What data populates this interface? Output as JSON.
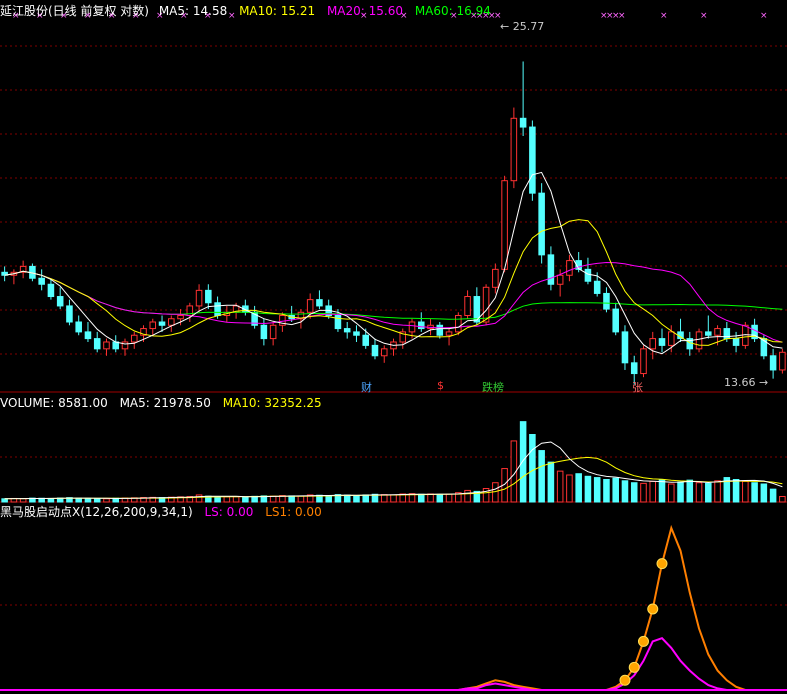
{
  "title": "延江股份(日线 前复权 对数)",
  "ma_legend": [
    {
      "label": "MA5: 14.58",
      "color": "#ffffff"
    },
    {
      "label": "MA10: 15.21",
      "color": "#ffff00"
    },
    {
      "label": "MA20: 15.60",
      "color": "#ff00ff"
    },
    {
      "label": "MA60: 16.94",
      "color": "#00ff00"
    }
  ],
  "volume_legend": [
    {
      "label": "VOLUME: 8581.00",
      "color": "#ffffff"
    },
    {
      "label": "MA5: 21978.50",
      "color": "#ffffff"
    },
    {
      "label": "MA10: 32352.25",
      "color": "#ffff00"
    }
  ],
  "indicator_legend": [
    {
      "label": "黑马股启动点X(12,26,200,9,34,1)",
      "color": "#ffffff"
    },
    {
      "label": "LS: 0.00",
      "color": "#ff00ff"
    },
    {
      "label": "LS1: 0.00",
      "color": "#ff8000"
    }
  ],
  "price_markers": {
    "high": "25.77",
    "low": "13.66"
  },
  "event_markers": [
    {
      "label": "财",
      "color": "#4da6ff"
    },
    {
      "label": "$",
      "color": "#ff3333"
    },
    {
      "label": "跌榜",
      "color": "#33cc33"
    },
    {
      "label": "张",
      "color": "#ff6666"
    }
  ],
  "colors": {
    "up": "#ff3232",
    "down": "#54ffff",
    "grid": "#800000",
    "ma5": "#ffffff",
    "ma10": "#ffff00",
    "ma20": "#ff00ff",
    "ma60": "#00ff00",
    "ls": "#ff00ff",
    "ls1": "#ff7f00"
  },
  "chart_data": {
    "type": "candlestick",
    "scale": "log",
    "price_range": [
      13.3,
      28.0
    ],
    "candles": [
      [
        16.9,
        17.1,
        16.6,
        16.8
      ],
      [
        16.8,
        17.0,
        16.5,
        16.9
      ],
      [
        16.9,
        17.3,
        16.7,
        17.1
      ],
      [
        17.1,
        17.2,
        16.6,
        16.7
      ],
      [
        16.7,
        17.0,
        16.3,
        16.5
      ],
      [
        16.5,
        16.7,
        16.0,
        16.1
      ],
      [
        16.1,
        16.4,
        15.7,
        15.8
      ],
      [
        15.8,
        16.0,
        15.2,
        15.3
      ],
      [
        15.3,
        15.5,
        14.9,
        15.0
      ],
      [
        15.0,
        15.3,
        14.7,
        14.8
      ],
      [
        14.8,
        15.0,
        14.4,
        14.5
      ],
      [
        14.5,
        14.8,
        14.3,
        14.7
      ],
      [
        14.7,
        14.9,
        14.4,
        14.5
      ],
      [
        14.5,
        14.8,
        14.3,
        14.7
      ],
      [
        14.7,
        15.0,
        14.5,
        14.9
      ],
      [
        14.9,
        15.2,
        14.7,
        15.1
      ],
      [
        15.1,
        15.4,
        14.9,
        15.3
      ],
      [
        15.3,
        15.5,
        15.0,
        15.2
      ],
      [
        15.2,
        15.5,
        15.0,
        15.4
      ],
      [
        15.4,
        15.7,
        15.2,
        15.5
      ],
      [
        15.5,
        15.9,
        15.3,
        15.8
      ],
      [
        15.8,
        16.5,
        15.6,
        16.3
      ],
      [
        16.3,
        16.5,
        15.7,
        15.9
      ],
      [
        15.9,
        16.1,
        15.4,
        15.5
      ],
      [
        15.5,
        15.8,
        15.3,
        15.6
      ],
      [
        15.6,
        15.9,
        15.4,
        15.8
      ],
      [
        15.8,
        16.0,
        15.5,
        15.6
      ],
      [
        15.6,
        15.8,
        15.1,
        15.2
      ],
      [
        15.2,
        15.4,
        14.6,
        14.8
      ],
      [
        14.8,
        15.3,
        14.6,
        15.2
      ],
      [
        15.2,
        15.6,
        15.0,
        15.5
      ],
      [
        15.5,
        15.8,
        15.3,
        15.4
      ],
      [
        15.4,
        15.7,
        15.1,
        15.6
      ],
      [
        15.6,
        16.2,
        15.4,
        16.0
      ],
      [
        16.0,
        16.3,
        15.7,
        15.8
      ],
      [
        15.8,
        16.0,
        15.4,
        15.5
      ],
      [
        15.5,
        15.7,
        15.0,
        15.1
      ],
      [
        15.1,
        15.3,
        14.8,
        15.0
      ],
      [
        15.0,
        15.2,
        14.7,
        14.9
      ],
      [
        14.9,
        15.1,
        14.5,
        14.6
      ],
      [
        14.6,
        14.8,
        14.2,
        14.3
      ],
      [
        14.3,
        14.6,
        14.1,
        14.5
      ],
      [
        14.5,
        14.8,
        14.3,
        14.7
      ],
      [
        14.7,
        15.1,
        14.5,
        15.0
      ],
      [
        15.0,
        15.4,
        14.8,
        15.3
      ],
      [
        15.3,
        15.6,
        15.0,
        15.1
      ],
      [
        15.1,
        15.4,
        14.9,
        15.2
      ],
      [
        15.2,
        15.3,
        14.8,
        14.9
      ],
      [
        14.9,
        15.1,
        14.6,
        15.0
      ],
      [
        15.0,
        15.6,
        14.9,
        15.5
      ],
      [
        15.5,
        16.3,
        15.4,
        16.1
      ],
      [
        16.1,
        16.4,
        15.2,
        15.3
      ],
      [
        15.3,
        16.5,
        15.2,
        16.4
      ],
      [
        16.4,
        17.2,
        16.2,
        17.0
      ],
      [
        17.0,
        20.5,
        16.9,
        20.3
      ],
      [
        20.3,
        23.5,
        20.0,
        23.0
      ],
      [
        23.0,
        25.77,
        22.2,
        22.6
      ],
      [
        22.6,
        22.9,
        19.5,
        19.8
      ],
      [
        19.8,
        20.2,
        17.2,
        17.5
      ],
      [
        17.5,
        17.8,
        16.3,
        16.5
      ],
      [
        16.5,
        17.0,
        16.1,
        16.8
      ],
      [
        16.8,
        17.5,
        16.6,
        17.3
      ],
      [
        17.3,
        17.6,
        16.9,
        17.0
      ],
      [
        17.0,
        17.4,
        16.5,
        16.6
      ],
      [
        16.6,
        16.9,
        16.1,
        16.2
      ],
      [
        16.2,
        16.4,
        15.6,
        15.7
      ],
      [
        15.7,
        15.9,
        14.9,
        15.0
      ],
      [
        15.0,
        15.2,
        13.9,
        14.1
      ],
      [
        14.1,
        14.3,
        13.5,
        13.8
      ],
      [
        13.8,
        14.6,
        13.7,
        14.5
      ],
      [
        14.5,
        15.0,
        14.2,
        14.8
      ],
      [
        14.8,
        15.1,
        14.4,
        14.6
      ],
      [
        14.6,
        15.2,
        14.4,
        15.0
      ],
      [
        15.0,
        15.4,
        14.7,
        14.8
      ],
      [
        14.8,
        15.0,
        14.3,
        14.5
      ],
      [
        14.5,
        15.1,
        14.4,
        15.0
      ],
      [
        15.0,
        15.5,
        14.8,
        14.9
      ],
      [
        14.9,
        15.2,
        14.6,
        15.1
      ],
      [
        15.1,
        15.3,
        14.7,
        14.8
      ],
      [
        14.8,
        15.0,
        14.4,
        14.6
      ],
      [
        14.6,
        15.3,
        14.5,
        15.2
      ],
      [
        15.2,
        15.4,
        14.7,
        14.8
      ],
      [
        14.8,
        14.9,
        14.2,
        14.3
      ],
      [
        14.3,
        14.5,
        13.66,
        13.9
      ],
      [
        13.9,
        14.5,
        13.8,
        14.4
      ]
    ],
    "volume_range": [
      0,
      140000
    ],
    "volume": [
      5000,
      5500,
      5200,
      6000,
      5800,
      5500,
      6200,
      6800,
      6000,
      5500,
      5200,
      5000,
      5800,
      6200,
      6500,
      7000,
      7200,
      6800,
      7500,
      8000,
      8500,
      11000,
      9000,
      8500,
      8000,
      8200,
      7800,
      8800,
      9500,
      9000,
      10000,
      9500,
      9200,
      11000,
      10500,
      10000,
      11500,
      10800,
      10200,
      11000,
      12000,
      11500,
      11000,
      12500,
      13000,
      12000,
      12500,
      11800,
      12200,
      14500,
      18000,
      16500,
      21000,
      30000,
      52000,
      95000,
      125000,
      105000,
      80000,
      62000,
      48000,
      42000,
      44000,
      40000,
      38000,
      35000,
      37000,
      33000,
      30000,
      29000,
      32000,
      35000,
      28000,
      31000,
      34000,
      30000,
      29000,
      33000,
      38000,
      35000,
      32000,
      30000,
      28000,
      20000,
      8581
    ]
  },
  "indicator": {
    "range": [
      0,
      100
    ],
    "ls1": [
      0,
      0,
      0,
      0,
      0,
      0,
      0,
      0,
      0,
      0,
      0,
      0,
      0,
      0,
      0,
      0,
      0,
      0,
      0,
      0,
      0,
      0,
      0,
      0,
      0,
      0,
      0,
      0,
      0,
      0,
      0,
      0,
      0,
      0,
      0,
      0,
      0,
      0,
      0,
      0,
      0,
      0,
      0,
      0,
      0,
      0,
      0,
      0,
      0,
      0,
      1,
      2,
      4,
      6,
      5,
      3,
      2,
      1,
      0,
      0,
      0,
      0,
      0,
      0,
      0,
      0,
      2,
      6,
      14,
      30,
      50,
      78,
      100,
      86,
      60,
      38,
      22,
      12,
      6,
      2,
      0,
      0,
      0,
      0,
      0
    ],
    "ls": [
      0,
      0,
      0,
      0,
      0,
      0,
      0,
      0,
      0,
      0,
      0,
      0,
      0,
      0,
      0,
      0,
      0,
      0,
      0,
      0,
      0,
      0,
      0,
      0,
      0,
      0,
      0,
      0,
      0,
      0,
      0,
      0,
      0,
      0,
      0,
      0,
      0,
      0,
      0,
      0,
      0,
      0,
      0,
      0,
      0,
      0,
      0,
      0,
      0,
      0,
      1,
      1,
      3,
      4,
      3,
      2,
      1,
      0,
      0,
      0,
      0,
      0,
      0,
      0,
      0,
      0,
      1,
      4,
      9,
      18,
      30,
      32,
      26,
      18,
      12,
      7,
      3,
      1,
      0,
      0,
      0,
      0,
      0,
      0,
      0
    ],
    "dot_indices": [
      67,
      68,
      69,
      70,
      71
    ]
  }
}
